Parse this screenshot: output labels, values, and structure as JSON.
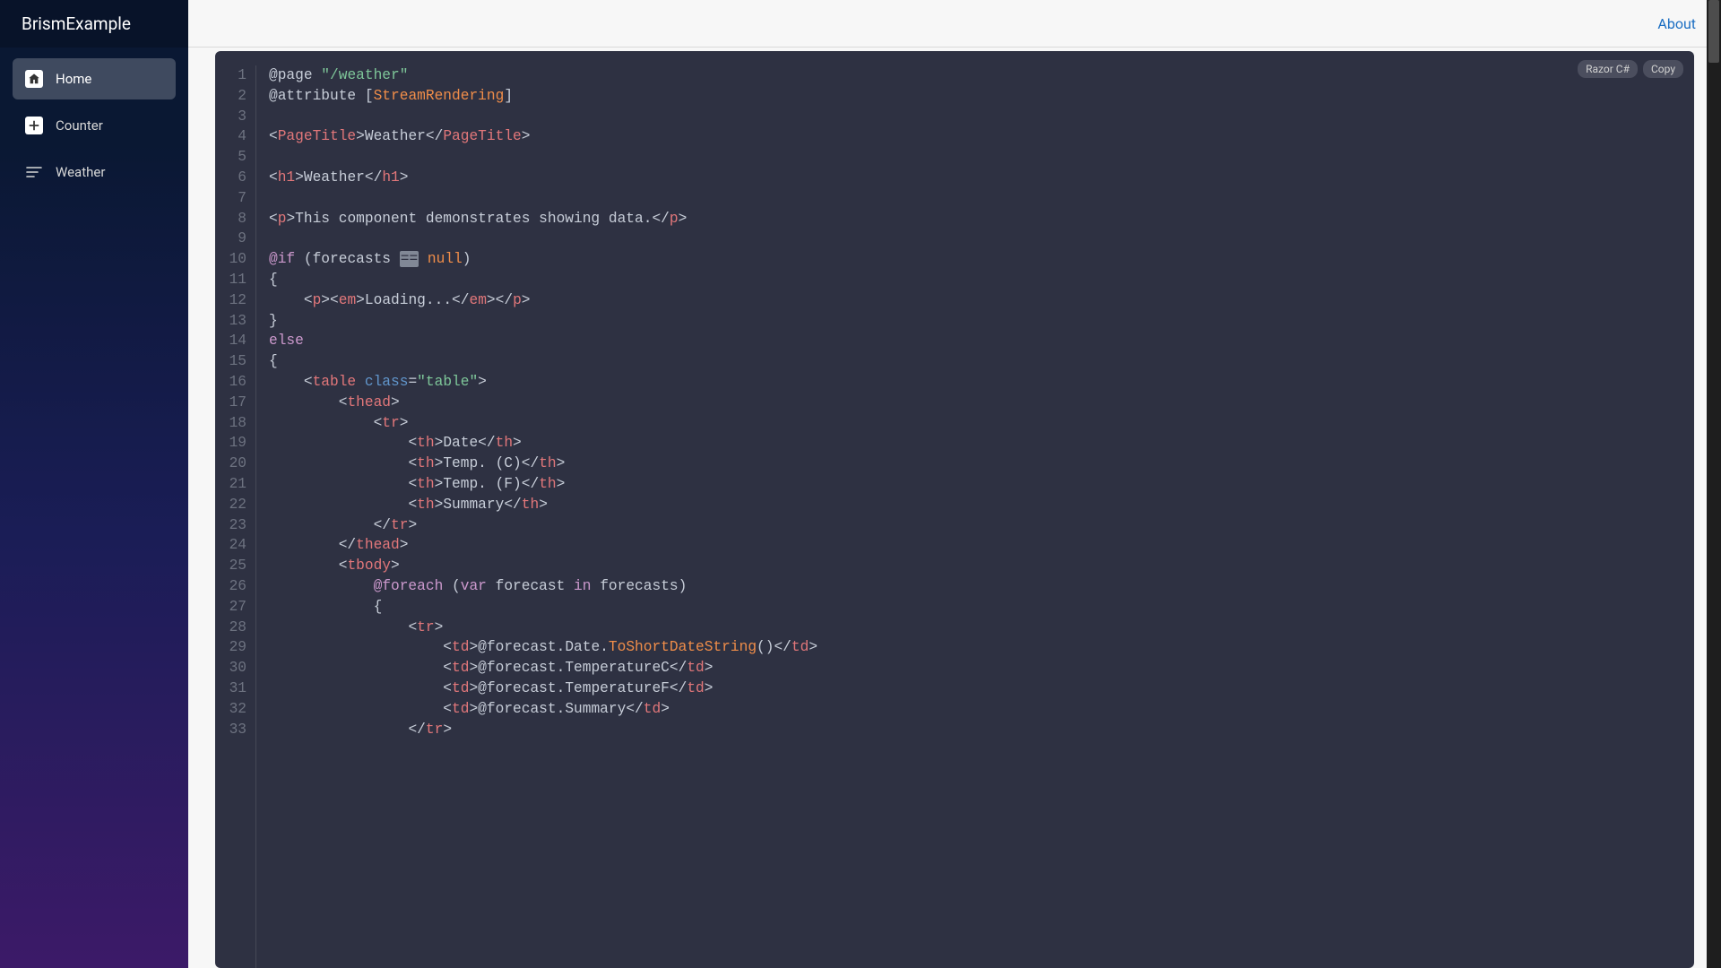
{
  "brand": "BrismExample",
  "topbar": {
    "about": "About"
  },
  "sidebar": {
    "items": [
      {
        "label": "Home"
      },
      {
        "label": "Counter"
      },
      {
        "label": "Weather"
      }
    ]
  },
  "code": {
    "language_badge": "Razor C#",
    "copy_badge": "Copy",
    "line_count": 33,
    "tokens": {
      "page_dir": "@page",
      "page_str": "\"/weather\"",
      "attr_dir": "@attribute",
      "attr_val": "StreamRendering",
      "pagetitle_tag": "PageTitle",
      "weather_txt": "Weather",
      "h1_tag": "h1",
      "p_tag": "p",
      "demo_txt": "This component demonstrates showing data.",
      "if_dir": "@if",
      "forecasts": "forecasts",
      "null_kw": "null",
      "em_tag": "em",
      "loading_txt": "Loading...",
      "else_kw": "else",
      "table_tag": "table",
      "class_attr": "class",
      "table_str": "\"table\"",
      "thead_tag": "thead",
      "tr_tag": "tr",
      "th_tag": "th",
      "th_date": "Date",
      "th_tempc": "Temp. (C)",
      "th_tempf": "Temp. (F)",
      "th_summary": "Summary",
      "tbody_tag": "tbody",
      "foreach_dir": "@foreach",
      "var_kw": "var",
      "forecast": "forecast",
      "in_kw": "in",
      "td_tag": "td",
      "at": "@",
      "date_prop": "forecast.Date.",
      "toshort": "ToShortDateString",
      "tempc_prop": "forecast.TemperatureC",
      "tempf_prop": "forecast.TemperatureF",
      "summary_prop": "forecast.Summary"
    }
  }
}
